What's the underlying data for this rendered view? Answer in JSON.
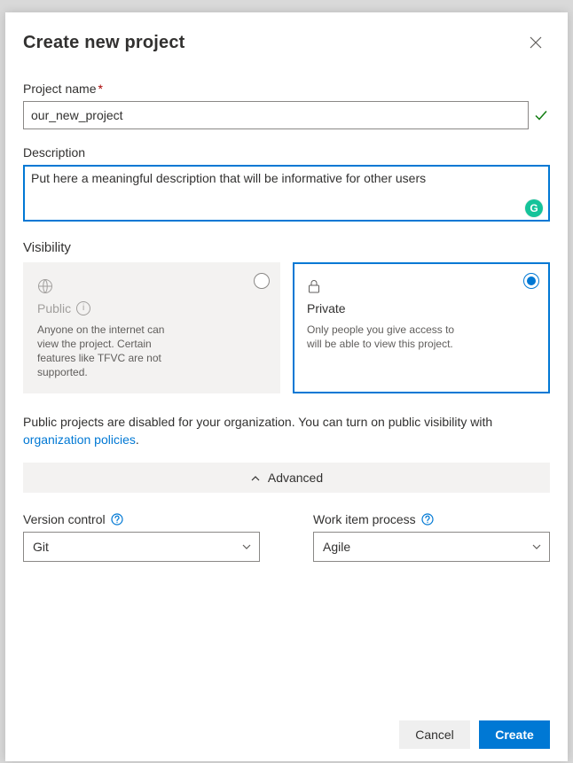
{
  "header": {
    "title": "Create new project"
  },
  "projectName": {
    "label": "Project name",
    "value": "our_new_project"
  },
  "description": {
    "label": "Description",
    "value": "Put here a meaningful description that will be informative for other users"
  },
  "visibility": {
    "label": "Visibility",
    "public": {
      "title": "Public",
      "desc": "Anyone on the internet can view the project. Certain features like TFVC are not supported.",
      "disabled": true
    },
    "private": {
      "title": "Private",
      "desc": "Only people you give access to will be able to view this project.",
      "selected": true
    }
  },
  "note": {
    "text": "Public projects are disabled for your organization. You can turn on public visibility with ",
    "linkText": "organization policies",
    "suffix": "."
  },
  "advanced": {
    "label": "Advanced"
  },
  "versionControl": {
    "label": "Version control",
    "value": "Git"
  },
  "workItemProcess": {
    "label": "Work item process",
    "value": "Agile"
  },
  "footer": {
    "cancel": "Cancel",
    "create": "Create"
  }
}
